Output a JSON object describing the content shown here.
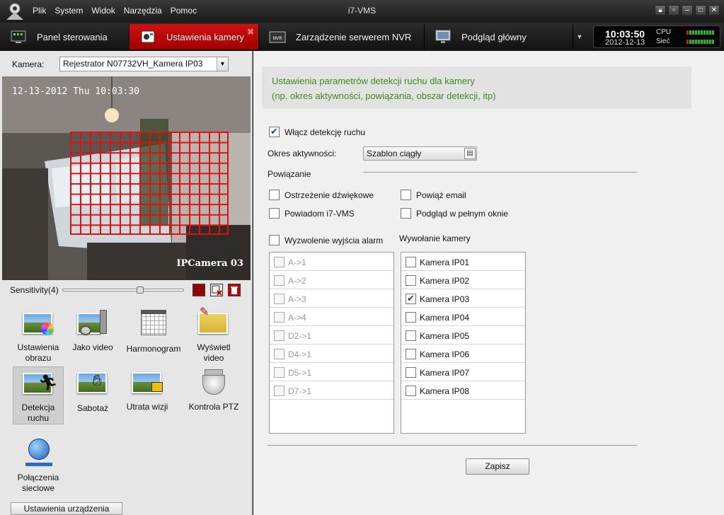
{
  "window": {
    "title": "i7-VMS",
    "controls": [
      "lock",
      "restore",
      "minimize",
      "maximize",
      "close"
    ]
  },
  "menu": [
    "Plik",
    "System",
    "Widok",
    "Narzędzia",
    "Pomoc"
  ],
  "tabs": [
    {
      "label": "Panel sterowania",
      "icon": "control-panel-icon",
      "active": false
    },
    {
      "label": "Ustawienia kamery",
      "icon": "camera-settings-icon",
      "active": true
    },
    {
      "label": "Zarządzenie serwerem NVR",
      "icon": "nvr-icon",
      "active": false
    },
    {
      "label": "Podgląd główny",
      "icon": "monitor-icon",
      "active": false
    }
  ],
  "status": {
    "time": "10:03:50",
    "date": "2012-12-13",
    "cpu_label": "CPU",
    "net_label": "Sieć"
  },
  "camera": {
    "label": "Kamera:",
    "selected": "Rejestrator N07732VH_Kamera IP03",
    "osd_time": "12-13-2012 Thu 10:03:30",
    "osd_name": "IPCamera 03"
  },
  "sensitivity": {
    "label": "Sensitivity(4)",
    "value": 4,
    "max": 10
  },
  "tools": [
    {
      "label": "Ustawienia obrazu",
      "icon": "image-settings-icon",
      "selected": false
    },
    {
      "label": "Jako video",
      "icon": "video-quality-icon",
      "selected": false
    },
    {
      "label": "Harmonogram",
      "icon": "calendar-icon",
      "selected": false
    },
    {
      "label": "Wyświetl video",
      "icon": "display-video-icon",
      "selected": false
    },
    {
      "label": "Detekcja ruchu",
      "icon": "motion-detection-icon",
      "selected": true
    },
    {
      "label": "Sabotaż",
      "icon": "tamper-icon",
      "selected": false
    },
    {
      "label": "Utrata wizji",
      "icon": "video-loss-icon",
      "selected": false
    },
    {
      "label": "Kontrola PTZ",
      "icon": "ptz-camera-icon",
      "selected": false
    },
    {
      "label": "Połączenia sieciowe",
      "icon": "network-globe-icon",
      "selected": false
    }
  ],
  "device_settings_button": "Ustawienia urządzenia",
  "panel": {
    "info_line1": "Ustawienia parametrów detekcji ruchu dla kamery",
    "info_line2": "(np. okres aktywności, powiązania, obszar detekcji, itp)",
    "enable_motion": {
      "label": "Włącz detekcję ruchu",
      "checked": true
    },
    "period_label": "Okres aktywności:",
    "period_value": "Szablon ciągły",
    "linkage_title": "Powiązanie",
    "linkage": [
      {
        "label": "Ostrzeżenie dźwiękowe",
        "checked": false
      },
      {
        "label": "Powiąż email",
        "checked": false
      },
      {
        "label": "Powiadom i7-VMS",
        "checked": false
      },
      {
        "label": "Podgląd w pełnym oknie",
        "checked": false
      }
    ],
    "alarm_out": {
      "label": "Wyzwolenie wyjścia alarm",
      "checked": false
    },
    "camera_call_title": "Wywołanie kamery",
    "alarm_outputs": [
      "A->1",
      "A->2",
      "A->3",
      "A->4",
      "D2->1",
      "D4->1",
      "D5->1",
      "D7->1"
    ],
    "cameras": [
      {
        "label": "Kamera IP01",
        "checked": false
      },
      {
        "label": "Kamera IP02",
        "checked": false
      },
      {
        "label": "Kamera IP03",
        "checked": true
      },
      {
        "label": "Kamera IP04",
        "checked": false
      },
      {
        "label": "Kamera IP05",
        "checked": false
      },
      {
        "label": "Kamera IP06",
        "checked": false
      },
      {
        "label": "Kamera IP07",
        "checked": false
      },
      {
        "label": "Kamera IP08",
        "checked": false
      }
    ],
    "save_label": "Zapisz"
  },
  "colors": {
    "active_tab": "#c00000",
    "grid": "#e01010",
    "info_text": "#3c8a1e"
  }
}
